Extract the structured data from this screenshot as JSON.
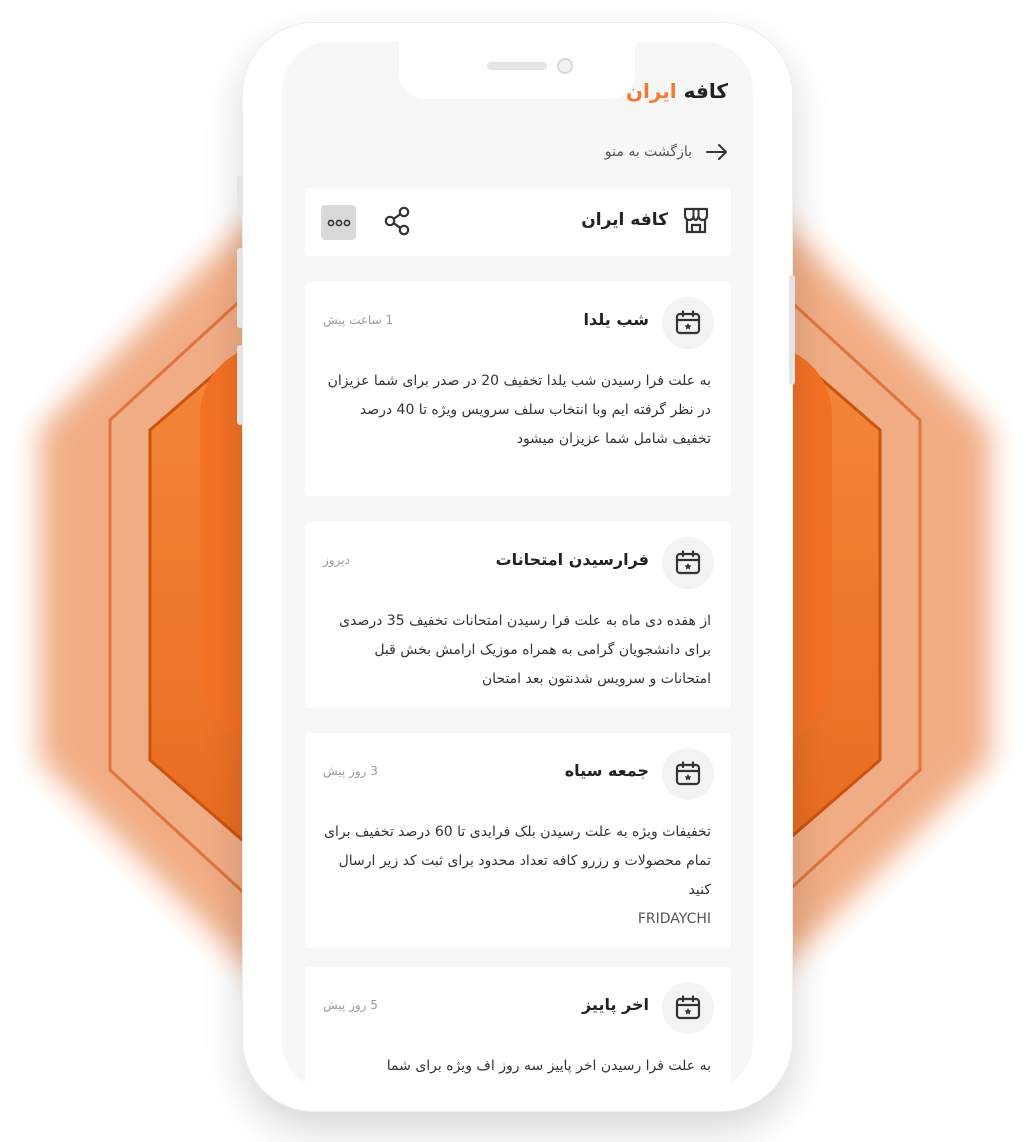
{
  "app": {
    "brand_prefix": "کافه",
    "brand_accent": "ایران",
    "accent_color": "#f47a2e"
  },
  "nav": {
    "back_label": "بازگشت به منو",
    "back_icon": "arrow-right-icon"
  },
  "shop_header": {
    "title": "کافه ایران",
    "icons": [
      "store-icon",
      "share-icon",
      "more-icon"
    ]
  },
  "notifications": [
    {
      "title": "شب یلدا",
      "time": "1 ساعت پیش",
      "body": "به علت فرا رسیدن شب یلدا  تخفیف 20 در صدر برای شما عزیزان در نظر گرفته ایم وبا انتخاب سلف سرویس ویژه تا 40 درصد تخفیف شامل شما عزیزان میشود",
      "code": "",
      "icon": "calendar-icon"
    },
    {
      "title": "فرارسیدن امتحانات",
      "time": "دیروز",
      "body": "از هفده دی ماه به علت فرا رسیدن امتحانات تخفیف 35 درصدی برای دانشجویان گرامی به همراه موزیک ارامش بخش قبل امتحانات و سرویس شدنتون بعد امتحان",
      "code": "",
      "icon": "calendar-icon"
    },
    {
      "title": "جمعه سیاه",
      "time": "3 روز پیش",
      "body": "تخفیفات ویژه به علت رسیدن بلک فرایدی  تا 60 درصد تخفیف برای تمام محصولات و رزرو کافه تعداد محدود برای ثبت کد زیر ارسال کنید",
      "code": "FRIDAYCHI",
      "icon": "calendar-icon"
    },
    {
      "title": "اخر پاییز",
      "time": "5 روز پیش",
      "body": "به علت فرا رسیدن اخر پاییز سه روز اف ویژه برای شما",
      "code": "",
      "icon": "calendar-icon"
    }
  ]
}
